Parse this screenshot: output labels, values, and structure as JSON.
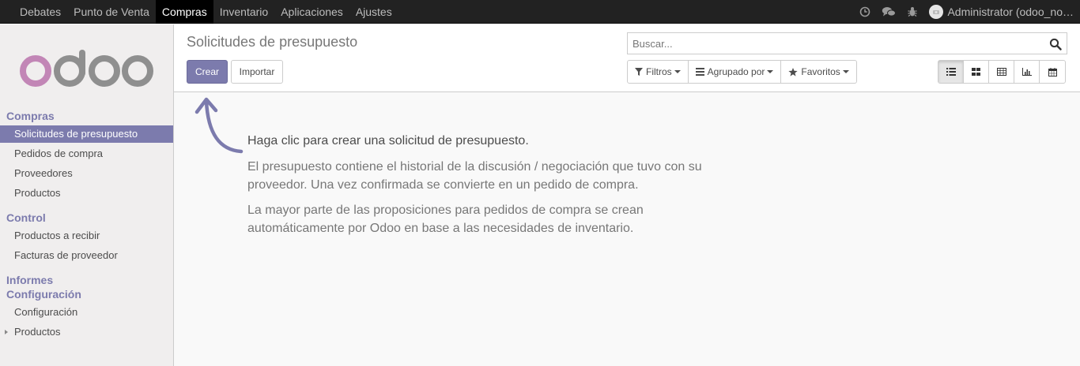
{
  "topbar": {
    "menu": [
      "Debates",
      "Punto de Venta",
      "Compras",
      "Inventario",
      "Aplicaciones",
      "Ajustes"
    ],
    "active_menu": "Compras",
    "user": "Administrator (odoo_no…",
    "icons": [
      "clock-icon",
      "chat-icon",
      "bug-icon"
    ]
  },
  "sidebar": {
    "logo_text": "odoo",
    "sections": [
      {
        "title": "Compras",
        "items": [
          {
            "label": "Solicitudes de presupuesto",
            "active": true
          },
          {
            "label": "Pedidos de compra"
          },
          {
            "label": "Proveedores"
          },
          {
            "label": "Productos"
          }
        ]
      },
      {
        "title": "Control",
        "items": [
          {
            "label": "Productos a recibir"
          },
          {
            "label": "Facturas de proveedor"
          }
        ]
      },
      {
        "title": "Informes",
        "items": []
      },
      {
        "title": "Configuración",
        "items": [
          {
            "label": "Configuración"
          },
          {
            "label": "Productos",
            "expandable": true
          }
        ]
      }
    ]
  },
  "control": {
    "title": "Solicitudes de presupuesto",
    "create_label": "Crear",
    "import_label": "Importar",
    "search_placeholder": "Buscar...",
    "filters_label": "Filtros",
    "groupby_label": "Agrupado por",
    "favorites_label": "Favoritos",
    "views": [
      "list-view-icon",
      "kanban-view-icon",
      "pivot-view-icon",
      "graph-view-icon",
      "calendar-view-icon"
    ],
    "active_view": "list-view-icon"
  },
  "help": {
    "title": "Haga clic para crear una solicitud de presupuesto.",
    "p1_line1": "El presupuesto contiene el historial de la discusión / negociación que tuvo con su",
    "p1_line2": "proveedor. Una vez confirmada se convierte en un pedido de compra.",
    "p2_line1": "La mayor parte de las proposiciones para pedidos de compra se crean",
    "p2_line2": "automáticamente por Odoo en base a las necesidades de inventario."
  },
  "colors": {
    "brand": "#7c7bad",
    "topbar": "#222222",
    "logo_o": "#c286b6",
    "logo_rest": "#8f8f8f"
  }
}
